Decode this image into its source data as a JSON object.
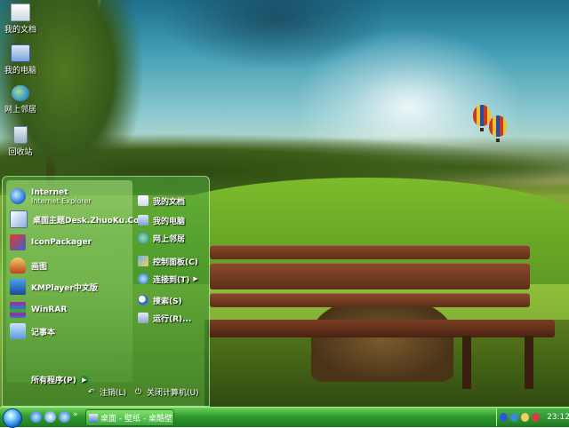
{
  "desktop": {
    "icons": [
      {
        "label": "我的文档",
        "icon": "documents-icon"
      },
      {
        "label": "我的电脑",
        "icon": "computer-icon"
      },
      {
        "label": "网上邻居",
        "icon": "network-icon"
      },
      {
        "label": "回收站",
        "icon": "recycle-bin-icon"
      }
    ]
  },
  "start_menu": {
    "pinned": [
      {
        "label": "Internet",
        "sub": "Internet Explorer",
        "icon": "internet-explorer-icon"
      },
      {
        "label": "桌面主题Desk.ZhuoKu.Com",
        "icon": "theme-icon"
      }
    ],
    "recent": [
      {
        "label": "IconPackager",
        "icon": "iconpackager-icon"
      },
      {
        "label": "画图",
        "icon": "paint-icon"
      },
      {
        "label": "KMPlayer中文版",
        "icon": "kmplayer-icon"
      },
      {
        "label": "WinRAR",
        "icon": "winrar-icon"
      },
      {
        "label": "记事本",
        "icon": "notepad-icon"
      }
    ],
    "all_programs": "所有程序(P)",
    "places": [
      {
        "label": "我的文档",
        "icon": "documents-icon"
      },
      {
        "label": "我的电脑",
        "icon": "computer-icon"
      },
      {
        "label": "网上邻居",
        "icon": "network-icon"
      },
      {
        "label": "控制面板(C)",
        "icon": "control-panel-icon"
      },
      {
        "label": "连接到(T)",
        "icon": "connect-icon"
      },
      {
        "label": "搜索(S)",
        "icon": "search-icon"
      },
      {
        "label": "运行(R)...",
        "icon": "run-icon"
      }
    ],
    "logoff": "注销(L)",
    "shutdown": "关闭计算机(U)"
  },
  "taskbar": {
    "quick_launch_more": "»",
    "task_button": "桌面 - 壁纸 - 桌酷壁...",
    "clock": "23:12"
  },
  "colors": {
    "taskbar_green": "#2e9a2e",
    "menu_green": "#50aa3c"
  }
}
